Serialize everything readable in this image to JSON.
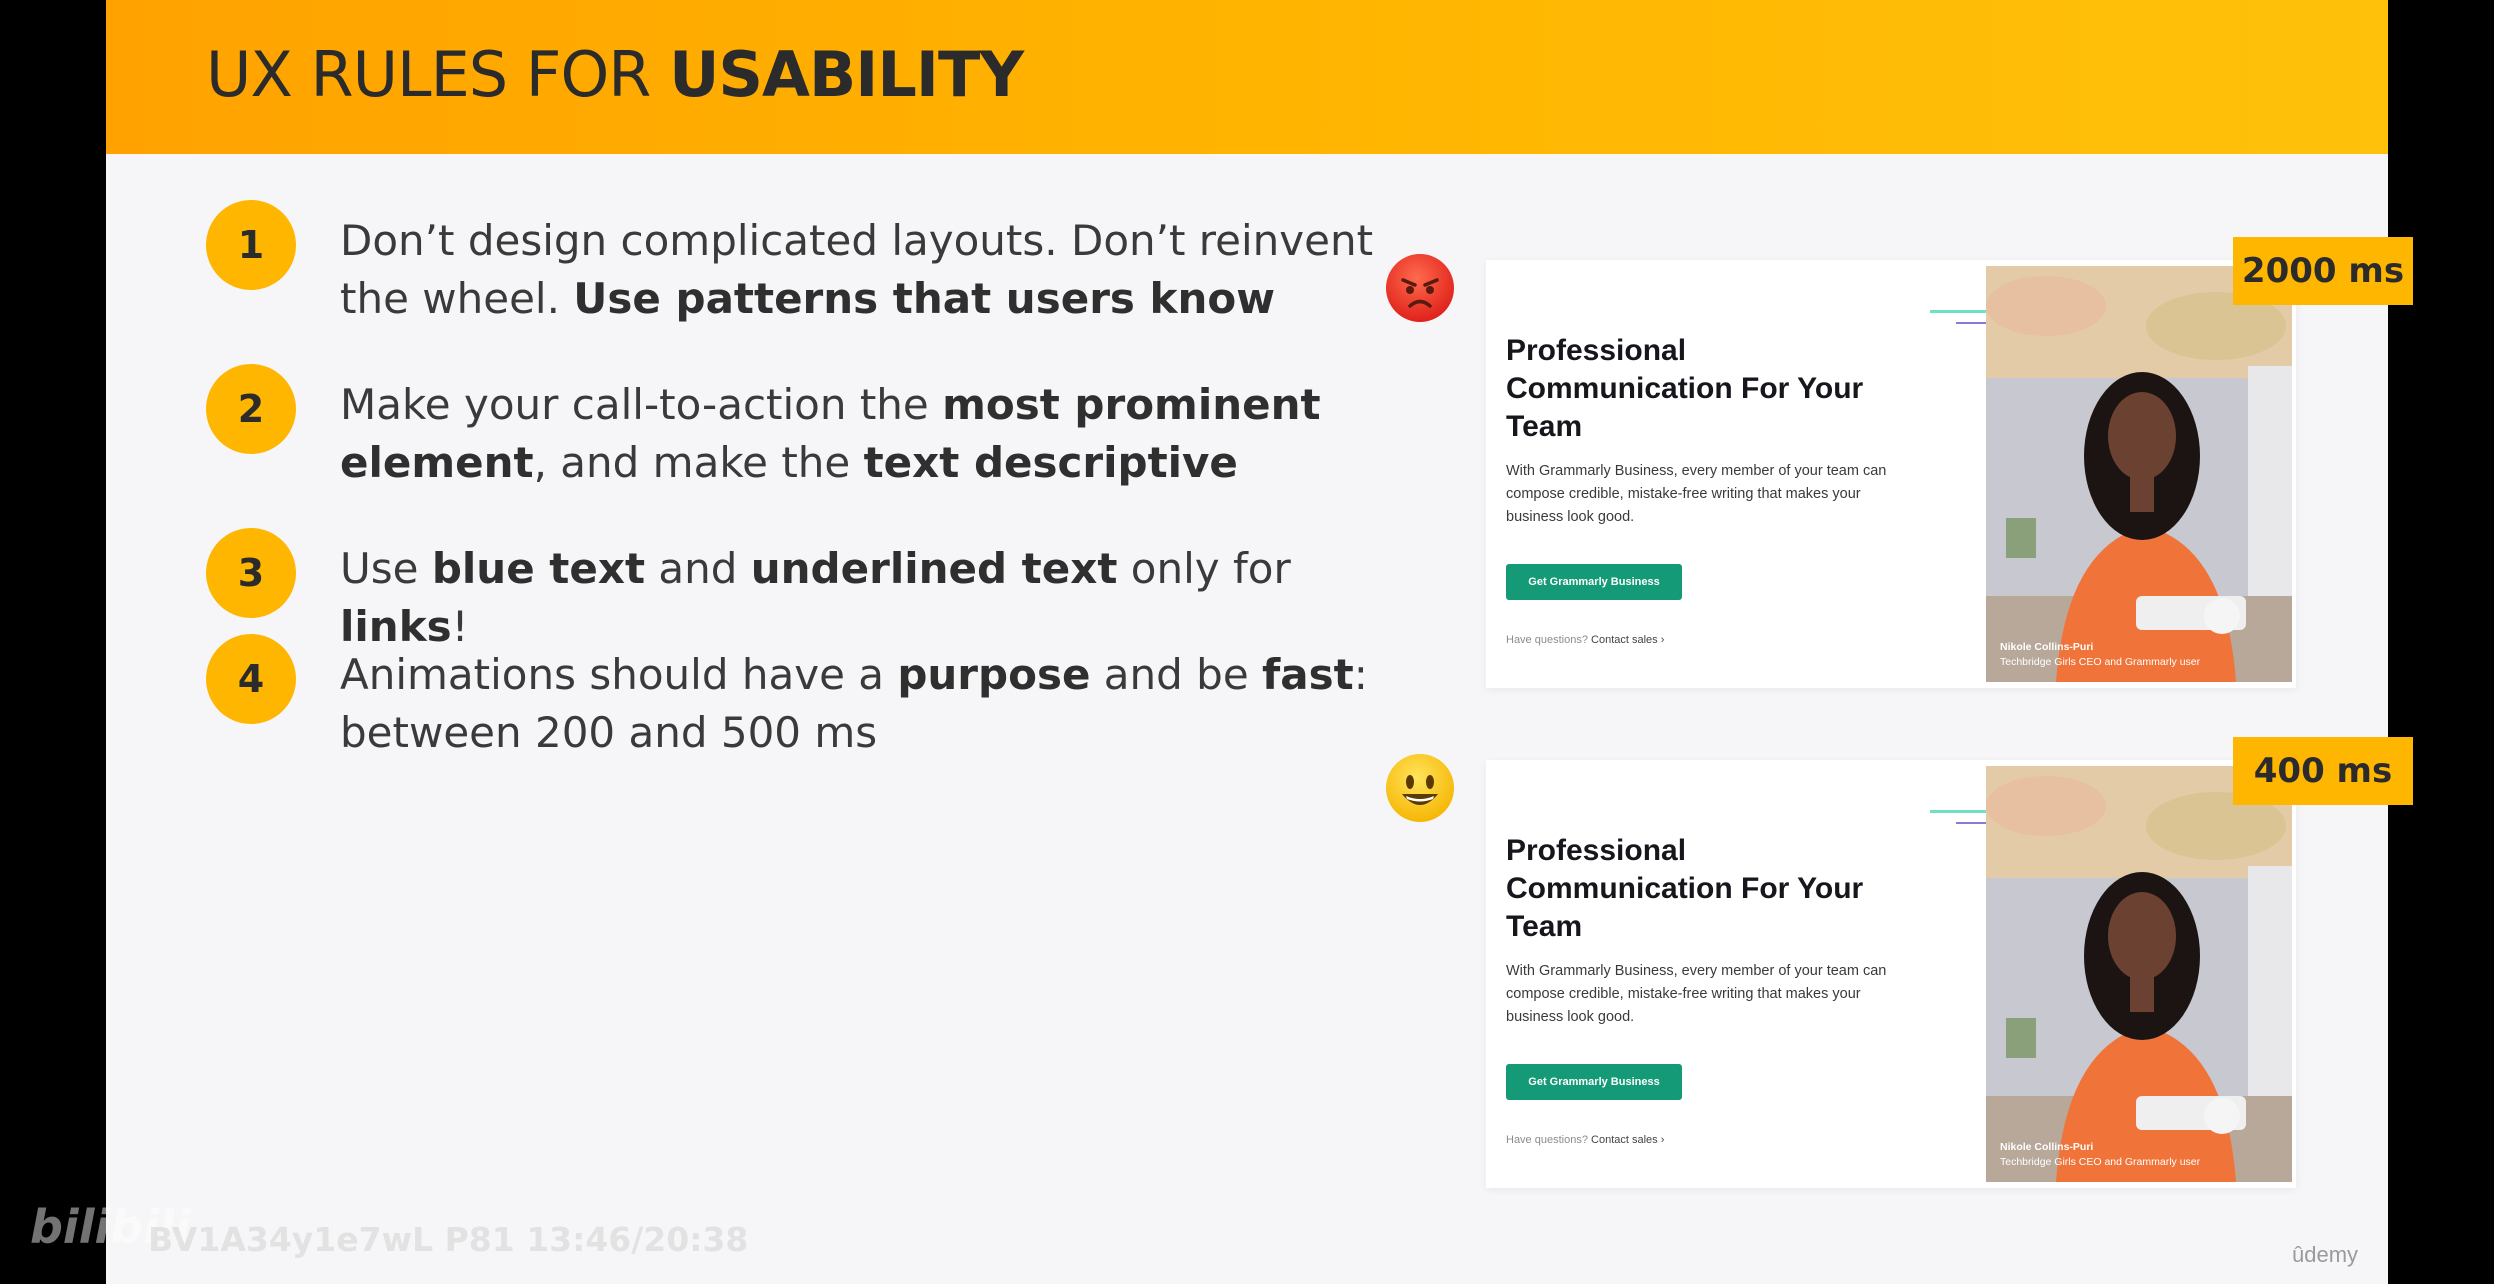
{
  "slide": {
    "title_regular": "UX RULES FOR ",
    "title_bold": "USABILITY"
  },
  "rules": [
    {
      "number": "1",
      "parts": [
        {
          "text": "Don’t design complicated layouts. Don’t reinvent the wheel. ",
          "bold": false
        },
        {
          "text": "Use patterns that users know",
          "bold": true
        }
      ]
    },
    {
      "number": "2",
      "parts": [
        {
          "text": "Make your call-to-action the ",
          "bold": false
        },
        {
          "text": "most prominent element",
          "bold": true
        },
        {
          "text": ", and make the ",
          "bold": false
        },
        {
          "text": "text descriptive",
          "bold": true
        }
      ]
    },
    {
      "number": "3",
      "parts": [
        {
          "text": "Use ",
          "bold": false
        },
        {
          "text": "blue text",
          "bold": true
        },
        {
          "text": " and ",
          "bold": false
        },
        {
          "text": "underlined text",
          "bold": true
        },
        {
          "text": " only for ",
          "bold": false
        },
        {
          "text": "links",
          "bold": true
        },
        {
          "text": "!",
          "bold": false
        }
      ]
    },
    {
      "number": "4",
      "parts": [
        {
          "text": "Animations should have a ",
          "bold": false
        },
        {
          "text": "purpose",
          "bold": true
        },
        {
          "text": " and be ",
          "bold": false
        },
        {
          "text": "fast",
          "bold": true
        },
        {
          "text": ": between 200 and 500 ms",
          "bold": false
        }
      ]
    }
  ],
  "examples": [
    {
      "duration": "2000 ms",
      "emoji": "angry-face-emoji",
      "card": {
        "heading": "Professional Communication For Your Team",
        "body": "With Grammarly Business, every member of your team can compose credible, mistake-free writing that makes your business look good.",
        "button": "Get Grammarly Business",
        "question": "Have questions?",
        "contact": "Contact sales ›",
        "caption_name": "Nikole Collins-Puri",
        "caption_role": "Techbridge Girls CEO and Grammarly user"
      }
    },
    {
      "duration": "400 ms",
      "emoji": "smiling-face-emoji",
      "card": {
        "heading": "Professional Communication For Your Team",
        "body": "With Grammarly Business, every member of your team can compose credible, mistake-free writing that makes your business look good.",
        "button": "Get Grammarly Business",
        "question": "Have questions?",
        "contact": "Contact sales ›",
        "caption_name": "Nikole Collins-Puri",
        "caption_role": "Techbridge Girls CEO and Grammarly user"
      }
    }
  ],
  "watermarks": {
    "bilibili_logo": "bilibili",
    "video_id": "BV1A34y1e7wL P81 13:46/20:38",
    "udemy": "ûdemy"
  },
  "colors": {
    "header_accent": "#ffb400",
    "number_badge": "#ffb600",
    "cta_green": "#149a76",
    "slide_background": "#f6f6f8"
  }
}
